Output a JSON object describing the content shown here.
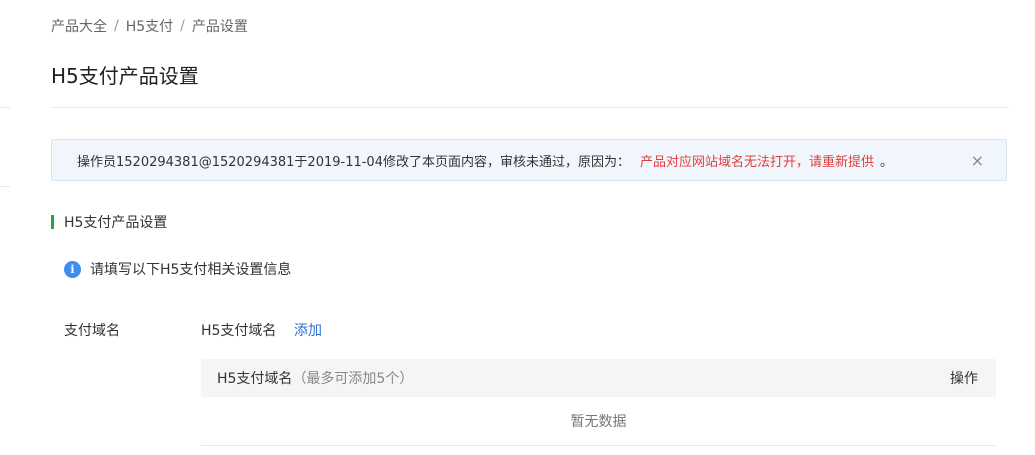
{
  "breadcrumb": {
    "items": [
      "产品大全",
      "H5支付",
      "产品设置"
    ],
    "separator": "/"
  },
  "page": {
    "title": "H5支付产品设置"
  },
  "alert": {
    "message": "操作员1520294381@1520294381于2019-11-04修改了本页面内容，审核未通过，原因为：",
    "reason": "产品对应网站域名无法打开，请重新提供",
    "period": "。",
    "close_symbol": "×",
    "reason_color": "#e23d3d"
  },
  "section": {
    "title": "H5支付产品设置",
    "accent_color": "#2ba246"
  },
  "info": {
    "icon_glyph": "i",
    "text": "请填写以下H5支付相关设置信息"
  },
  "form": {
    "field_label": "支付域名",
    "domain_label": "H5支付域名",
    "add_label": "添加"
  },
  "table": {
    "col_domain": "H5支付域名",
    "col_hint": "（最多可添加5个）",
    "col_op": "操作",
    "empty_text": "暂无数据"
  }
}
